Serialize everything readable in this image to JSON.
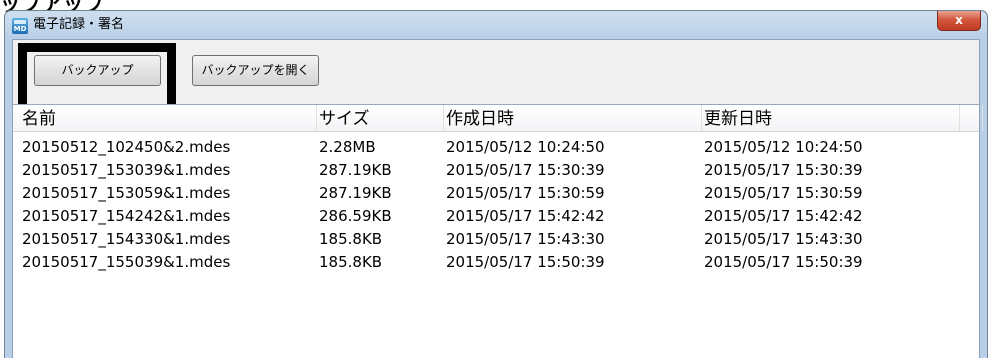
{
  "caption": "ップアップ",
  "window": {
    "title": "電子記録・署名",
    "close_label": "x"
  },
  "toolbar": {
    "backup_label": "バックアップ",
    "open_backup_label": "バックアップを開く"
  },
  "list": {
    "columns": [
      "名前",
      "サイズ",
      "作成日時",
      "更新日時"
    ],
    "rows": [
      [
        "20150512_102450&2.mdes",
        "2.28MB",
        "2015/05/12 10:24:50",
        "2015/05/12 10:24:50"
      ],
      [
        "20150517_153039&1.mdes",
        "287.19KB",
        "2015/05/17 15:30:39",
        "2015/05/17 15:30:39"
      ],
      [
        "20150517_153059&1.mdes",
        "287.19KB",
        "2015/05/17 15:30:59",
        "2015/05/17 15:30:59"
      ],
      [
        "20150517_154242&1.mdes",
        "286.59KB",
        "2015/05/17 15:42:42",
        "2015/05/17 15:42:42"
      ],
      [
        "20150517_154330&1.mdes",
        "185.8KB",
        "2015/05/17 15:43:30",
        "2015/05/17 15:43:30"
      ],
      [
        "20150517_155039&1.mdes",
        "185.8KB",
        "2015/05/17 15:50:39",
        "2015/05/17 15:50:39"
      ]
    ]
  },
  "icons": {
    "app": "md-app-icon"
  }
}
